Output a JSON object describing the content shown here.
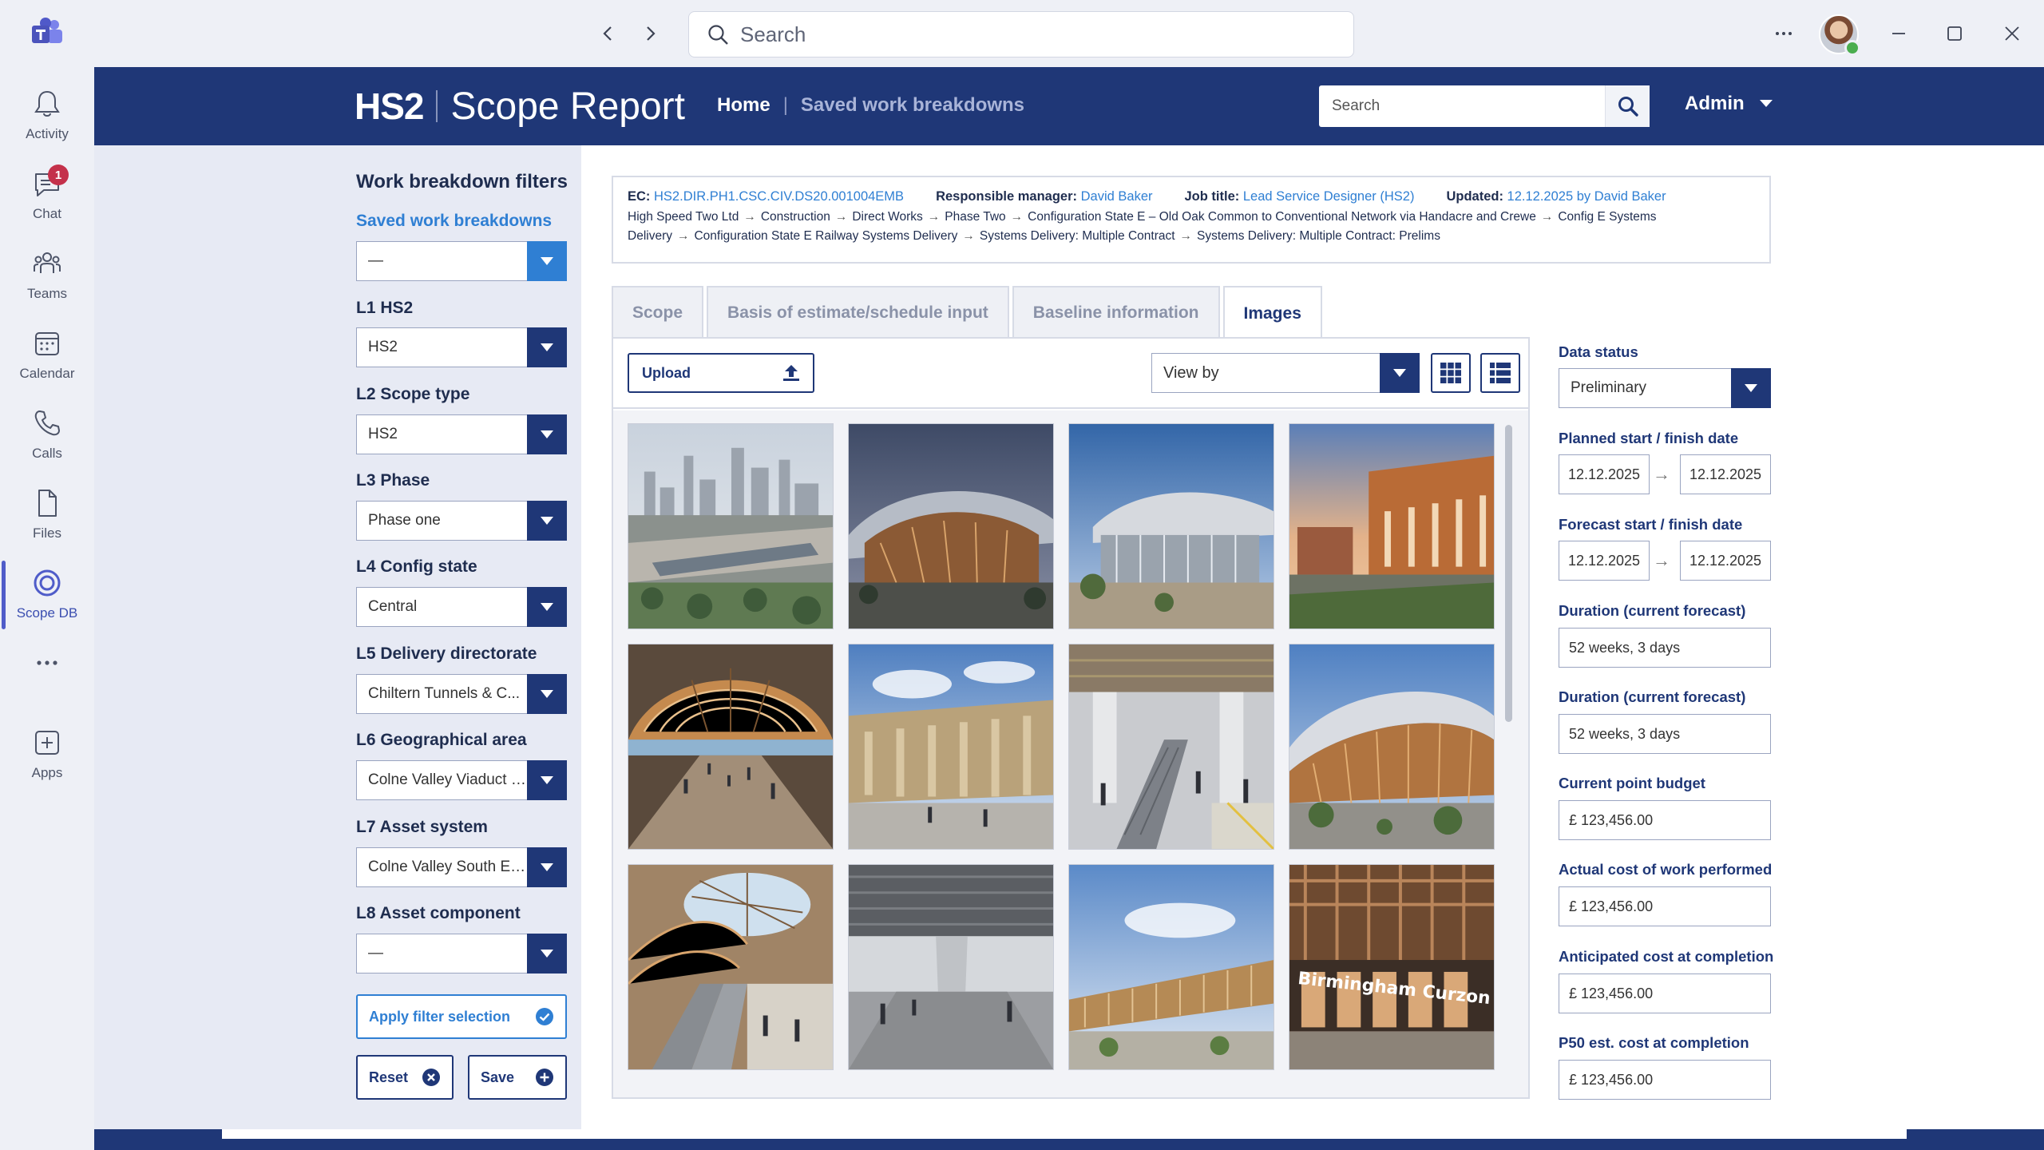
{
  "titlebar": {
    "search_placeholder": "Search",
    "more_icon": "more-icon",
    "window_controls": [
      "minimize-icon",
      "maximize-icon",
      "close-icon"
    ]
  },
  "rail": {
    "items": [
      {
        "label": "Activity",
        "icon": "bell-icon"
      },
      {
        "label": "Chat",
        "icon": "chat-icon",
        "badge": "1"
      },
      {
        "label": "Teams",
        "icon": "teams-icon"
      },
      {
        "label": "Calendar",
        "icon": "calendar-icon"
      },
      {
        "label": "Calls",
        "icon": "phone-icon"
      },
      {
        "label": "Files",
        "icon": "file-icon"
      },
      {
        "label": "Scope DB",
        "icon": "scope-db-icon",
        "active": true
      },
      {
        "label": "",
        "icon": "more-icon"
      },
      {
        "label": "Apps",
        "icon": "apps-icon"
      }
    ]
  },
  "header": {
    "brand": "HS2",
    "title": "Scope Report",
    "nav_home": "Home",
    "nav_sep": "|",
    "nav_saved": "Saved work breakdowns",
    "search_placeholder": "Search",
    "user": "Admin"
  },
  "filters": {
    "title": "Work breakdown filters",
    "saved_label": "Saved work breakdowns",
    "saved_value": "—",
    "fields": [
      {
        "label": "L1 HS2",
        "value": "HS2"
      },
      {
        "label": "L2 Scope type",
        "value": "HS2"
      },
      {
        "label": "L3 Phase",
        "value": "Phase one"
      },
      {
        "label": "L4 Config state",
        "value": "Central"
      },
      {
        "label": "L5 Delivery directorate",
        "value": "Chiltern Tunnels & C..."
      },
      {
        "label": "L6 Geographical area",
        "value": "Colne Valley Viaduct &..."
      },
      {
        "label": "L7 Asset system",
        "value": "Colne Valley South Em..."
      },
      {
        "label": "L8 Asset component",
        "value": "—"
      }
    ],
    "apply_label": "Apply filter selection",
    "reset_label": "Reset",
    "save_label": "Save"
  },
  "info": {
    "ec_label": "EC:",
    "ec_value": "HS2.DIR.PH1.CSC.CIV.DS20.001004EMB",
    "manager_label": "Responsible manager:",
    "manager_value": "David Baker",
    "job_label": "Job title:",
    "job_value": "Lead Service Designer (HS2)",
    "updated_label": "Updated:",
    "updated_value": "12.12.2025 by David Baker",
    "breadcrumb": [
      "High Speed Two Ltd",
      "Construction",
      "Direct Works",
      "Phase Two",
      "Configuration State E  – Old Oak Common to Conventional Network via Handacre and Crewe",
      "Config E Systems Delivery",
      "Configuration State E Railway Systems Delivery",
      "Systems Delivery: Multiple Contract",
      "Systems Delivery: Multiple Contract: Prelims"
    ]
  },
  "tabs": [
    "Scope",
    "Basis of estimate/schedule input",
    "Baseline information",
    "Images"
  ],
  "active_tab": "Images",
  "toolbar": {
    "upload_label": "Upload",
    "view_by_label": "View  by"
  },
  "images": [
    {
      "scene": "city-aerial"
    },
    {
      "scene": "canopy-dusk"
    },
    {
      "scene": "canopy-day"
    },
    {
      "scene": "sunset-plaza"
    },
    {
      "scene": "hall-interior"
    },
    {
      "scene": "station-street"
    },
    {
      "scene": "concourse-escalator"
    },
    {
      "scene": "canopy-garden"
    },
    {
      "scene": "atrium-escalator"
    },
    {
      "scene": "undercroft"
    },
    {
      "scene": "long-facade"
    },
    {
      "scene": "birmingham-entrance",
      "sign": "Birmingham Curzon Street"
    }
  ],
  "details": {
    "data_status_label": "Data status",
    "data_status_value": "Preliminary",
    "planned_label": "Planned start / finish date",
    "planned_start": "12.12.2025",
    "planned_finish": "12.12.2025",
    "forecast_label": "Forecast start / finish date",
    "forecast_start": "12.12.2025",
    "forecast_finish": "12.12.2025",
    "date_arrow": "→",
    "duration1_label": "Duration (current forecast)",
    "duration1_value": "52 weeks, 3 days",
    "duration2_label": "Duration (current forecast)",
    "duration2_value": "52 weeks, 3 days",
    "budget_label": "Current point budget",
    "budget_value": "£ 123,456.00",
    "actual_label": "Actual cost of work performed",
    "actual_value": "£ 123,456.00",
    "anticipated_label": "Anticipated cost at completion",
    "anticipated_value": "£ 123,456.00",
    "p50_label": "P50 est. cost at completion",
    "p50_value": "£ 123,456.00"
  },
  "colors": {
    "navy": "#1f3777",
    "accent_blue": "#2f7fd3",
    "teams_purple": "#4f5cc9",
    "badge_red": "#c4314b"
  }
}
